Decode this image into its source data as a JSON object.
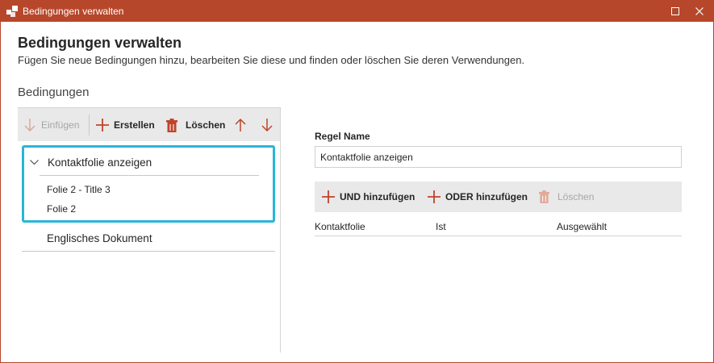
{
  "window": {
    "title": "Bedingungen verwalten",
    "accent_color": "#b7472a",
    "highlight_color": "#29b6d8"
  },
  "header": {
    "title": "Bedingungen verwalten",
    "description": "Fügen Sie neue Bedingungen hinzu, bearbeiten Sie diese und finden oder löschen Sie deren Verwendungen."
  },
  "conditions": {
    "section_title": "Bedingungen",
    "toolbar": {
      "insert_label": "Einfügen",
      "create_label": "Erstellen",
      "delete_label": "Löschen"
    },
    "tree": {
      "selected_group": {
        "label": "Kontaktfolie anzeigen",
        "children": [
          "Folie 2 - Title 3",
          "Folie 2"
        ]
      },
      "items": [
        "Englisches Dokument"
      ]
    }
  },
  "rule": {
    "name_label": "Regel Name",
    "name_value": "Kontaktfolie anzeigen",
    "toolbar": {
      "and_label": "UND hinzufügen",
      "or_label": "ODER hinzufügen",
      "delete_label": "Löschen"
    },
    "table": {
      "columns": [
        "Kontaktfolie",
        "Ist",
        "Ausgewählt"
      ]
    }
  }
}
